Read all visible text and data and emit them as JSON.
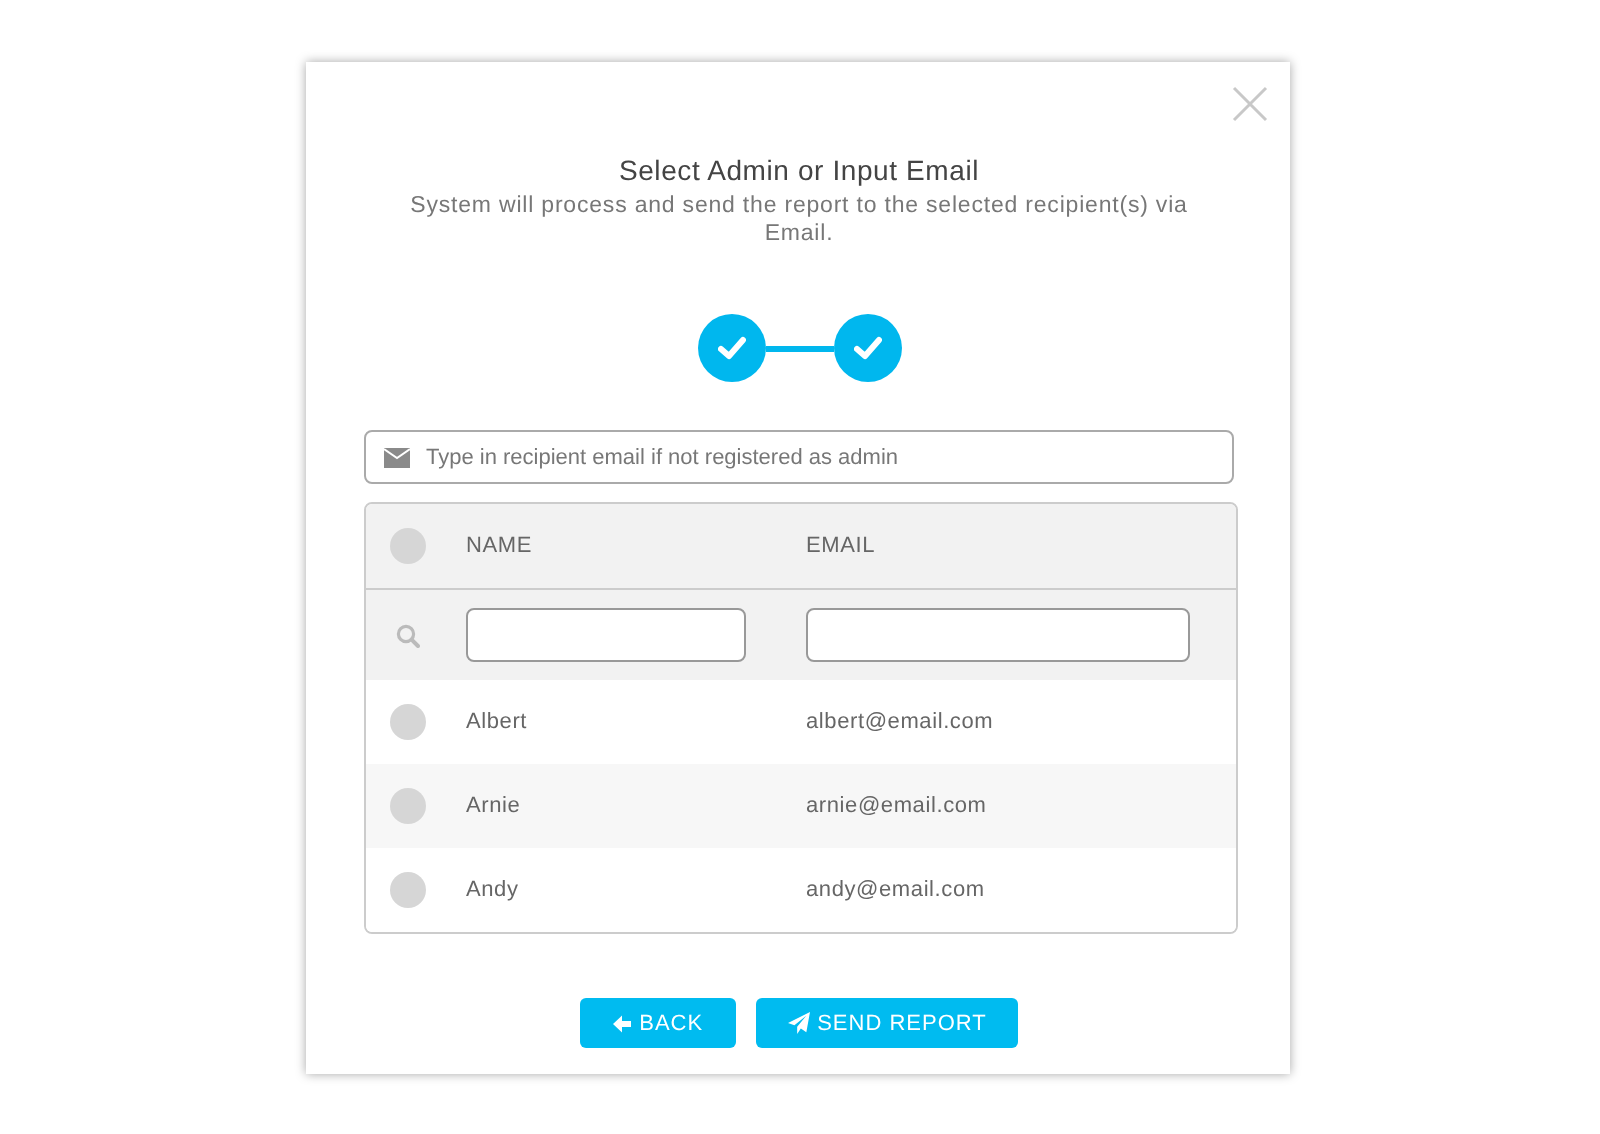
{
  "dialog": {
    "title": "Select Admin or Input Email",
    "subtitle": "System will process and send the report to the selected recipient(s) via Email."
  },
  "steps": [
    {
      "done": true
    },
    {
      "done": true
    }
  ],
  "recipient_field": {
    "placeholder": "Type in recipient email if not registered as admin"
  },
  "table": {
    "select_all": {
      "selected": false
    },
    "columns": [
      "NAME",
      "EMAIL"
    ],
    "rows": [
      {
        "name": "Albert",
        "email": "albert@email.com",
        "selected": false
      },
      {
        "name": "Arnie",
        "email": "arnie@email.com",
        "selected": false
      },
      {
        "name": "Andy",
        "email": "andy@email.com",
        "selected": false
      }
    ]
  },
  "buttons": [
    {
      "kind": "back",
      "label": "BACK"
    },
    {
      "kind": "send",
      "label": "SEND REPORT"
    }
  ]
}
